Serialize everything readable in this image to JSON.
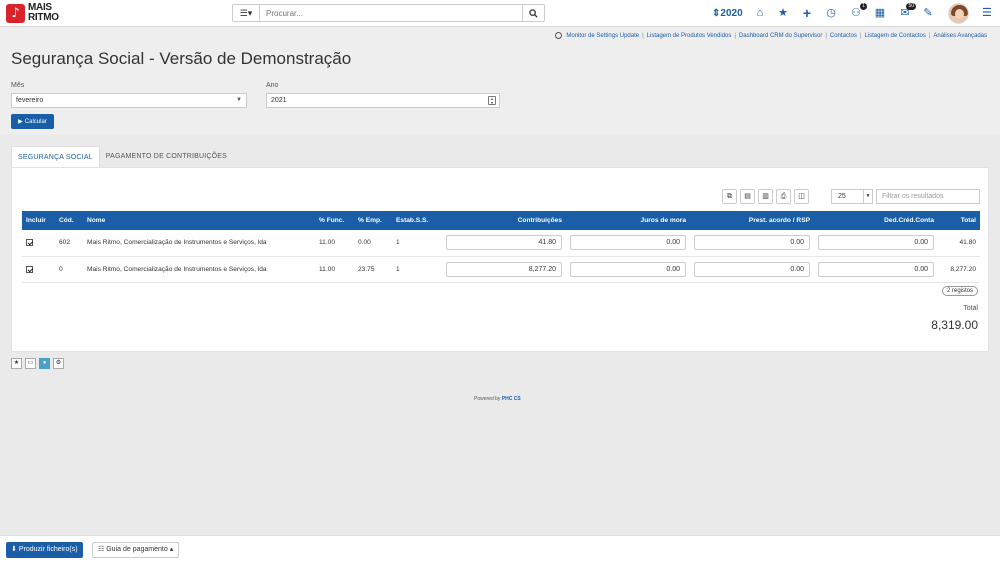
{
  "topbar": {
    "logo_line1": "MAIS",
    "logo_line2": "RITMO",
    "search_placeholder": "Procurar...",
    "year": "2020",
    "badges": {
      "users": "1",
      "messages": "50"
    }
  },
  "links": [
    "Monitor de Settings Update",
    "Listagem de Produtos Vendidos",
    "Dashboard CRM do Supervisor",
    "Contactos",
    "Listagem de Contactos",
    "Análises Avançadas"
  ],
  "page_title": "Segurança Social - Versão de Demonstração",
  "form": {
    "mes_label": "Mês",
    "mes_value": "fevereiro",
    "ano_label": "Ano",
    "ano_value": "2021",
    "calc_label": "Calcular"
  },
  "tabs": [
    "SEGURANÇA SOCIAL",
    "PAGAMENTO DE CONTRIBUIÇÕES"
  ],
  "grid": {
    "page_size": "25",
    "filter_placeholder": "Filtrar os resultados",
    "headers": [
      "Incluir",
      "Cód.",
      "Nome",
      "% Func.",
      "% Emp.",
      "Estab.S.S.",
      "Contribuições",
      "Juros de mora",
      "Prest. acordo / RSP",
      "Ded.Créd.Conta",
      "Total"
    ],
    "rows": [
      {
        "cod": "602",
        "nome": "Mais Ritmo, Comercialização de Instrumentos e Serviços, lda",
        "func": "11.00",
        "emp": "0.00",
        "estab": "1",
        "contrib": "41.80",
        "juros": "0.00",
        "prest": "0.00",
        "ded": "0.00",
        "total": "41.80"
      },
      {
        "cod": "0",
        "nome": "Mais Ritmo, Comercialização de Instrumentos e Serviços, lda",
        "func": "11.00",
        "emp": "23.75",
        "estab": "1",
        "contrib": "8,277.20",
        "juros": "0.00",
        "prest": "0.00",
        "ded": "0.00",
        "total": "8,277.20"
      }
    ],
    "registos": "2 registos",
    "total_label": "Total",
    "total_value": "8,319.00"
  },
  "powered": {
    "prefix": "Powered by",
    "brand": "PHC CS"
  },
  "footer": {
    "produzir": "Produzir ficheiro(s)",
    "guia": "Guia de pagamento"
  }
}
